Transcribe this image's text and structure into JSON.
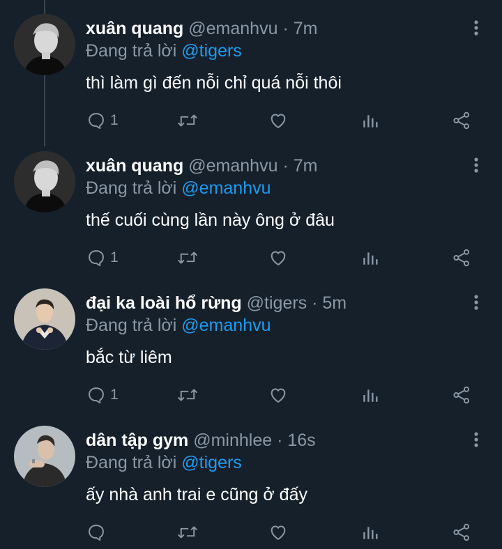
{
  "tweets": [
    {
      "name": "xuân quang",
      "handle": "@emanhvu",
      "dot": "·",
      "time": "7m",
      "reply_prefix": "Đang trả lời",
      "reply_to": "@tigers",
      "text": "thì làm gì đến nỗi chỉ quá nỗi thôi",
      "reply_count": "1"
    },
    {
      "name": "xuân quang",
      "handle": "@emanhvu",
      "dot": "·",
      "time": "7m",
      "reply_prefix": "Đang trả lời",
      "reply_to": "@emanhvu",
      "text": "thế cuối cùng lần này ông ở đâu",
      "reply_count": "1"
    },
    {
      "name": "đại ka loài hổ rừng",
      "handle": "@tigers",
      "dot": "·",
      "time": "5m",
      "reply_prefix": "Đang trả lời",
      "reply_to": "@emanhvu",
      "text": "bắc từ liêm",
      "reply_count": "1"
    },
    {
      "name": "dân tập gym",
      "handle": "@minhlee",
      "dot": "·",
      "time": "16s",
      "reply_prefix": "Đang trả lời",
      "reply_to": "@tigers",
      "text": "ấy nhà anh trai e cũng ở đấy",
      "reply_count": ""
    }
  ],
  "icons": {
    "reply": "reply-icon",
    "retweet": "retweet-icon",
    "like": "heart-icon",
    "stats": "stats-icon",
    "share": "share-icon",
    "more": "more-vertical-icon"
  },
  "colors": {
    "background": "#15202b",
    "accent": "#1d9bf0",
    "muted": "#8b98a5",
    "text": "#ffffff"
  }
}
